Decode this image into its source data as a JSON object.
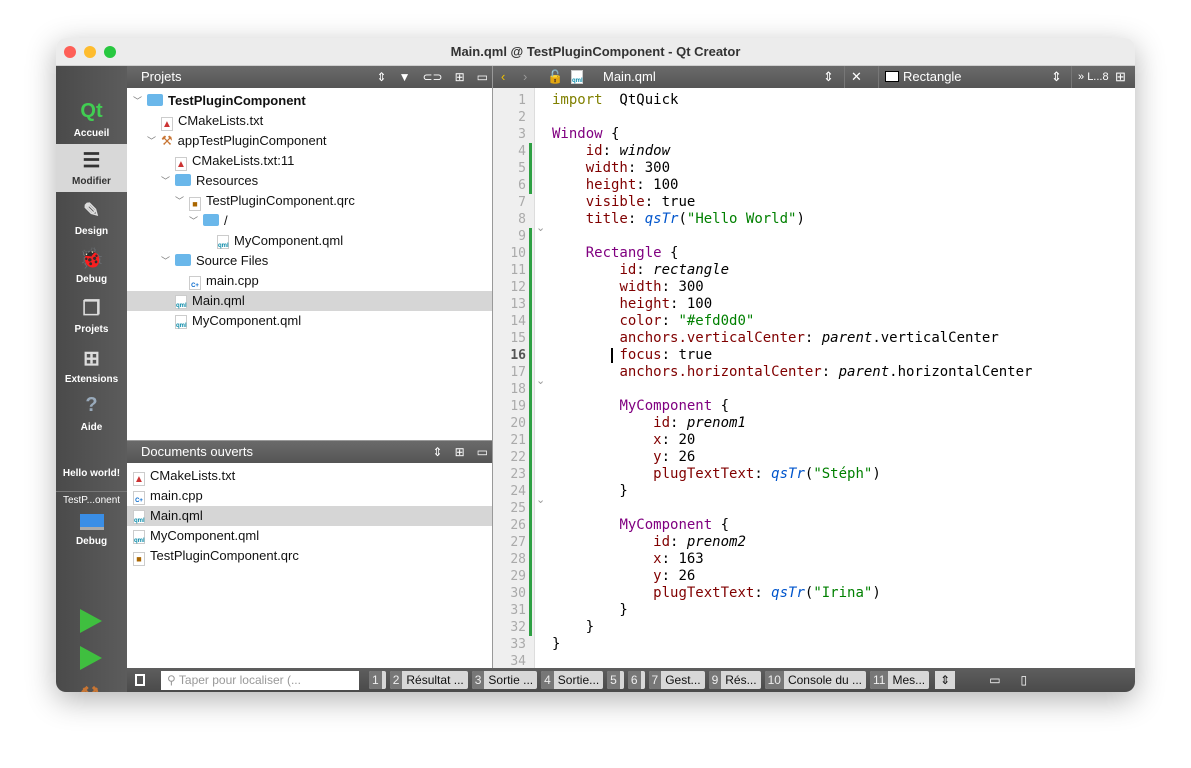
{
  "window": {
    "title": "Main.qml @ TestPluginComponent - Qt Creator"
  },
  "modes": [
    {
      "label": "Accueil",
      "icon": "qt-logo-icon"
    },
    {
      "label": "Modifier",
      "icon": "edit-document-icon"
    },
    {
      "label": "Design",
      "icon": "design-brush-icon"
    },
    {
      "label": "Debug",
      "icon": "debug-bug-icon"
    },
    {
      "label": "Projets",
      "icon": "projects-folder-icon"
    },
    {
      "label": "Extensions",
      "icon": "extensions-icon"
    },
    {
      "label": "Aide",
      "icon": "help-icon"
    }
  ],
  "run": {
    "project": "Hello world!",
    "target": "TestP...onent",
    "build_config": "Debug"
  },
  "projects": {
    "title": "Projets",
    "tree": [
      {
        "label": "TestPluginComponent",
        "depth": 0,
        "icon": "project-folder",
        "bold": true,
        "arrow": true
      },
      {
        "label": "CMakeLists.txt",
        "depth": 1,
        "icon": "cmake"
      },
      {
        "label": "appTestPluginComponent",
        "depth": 1,
        "icon": "hammer",
        "arrow": true
      },
      {
        "label": "CMakeLists.txt:11",
        "depth": 2,
        "icon": "cmake"
      },
      {
        "label": "Resources",
        "depth": 2,
        "icon": "folder-lock",
        "arrow": true
      },
      {
        "label": "TestPluginComponent.qrc",
        "depth": 3,
        "icon": "qrc",
        "arrow": true
      },
      {
        "label": "/",
        "depth": 4,
        "icon": "folder",
        "arrow": true
      },
      {
        "label": "MyComponent.qml",
        "depth": 5,
        "icon": "qml"
      },
      {
        "label": "Source Files",
        "depth": 2,
        "icon": "folder-cpp",
        "arrow": true
      },
      {
        "label": "main.cpp",
        "depth": 3,
        "icon": "cpp"
      },
      {
        "label": "Main.qml",
        "depth": 2,
        "icon": "qml",
        "selected": true
      },
      {
        "label": "MyComponent.qml",
        "depth": 2,
        "icon": "qml"
      }
    ]
  },
  "open_docs": {
    "title": "Documents ouverts",
    "items": [
      {
        "label": "CMakeLists.txt",
        "icon": "cmake"
      },
      {
        "label": "main.cpp",
        "icon": "cpp"
      },
      {
        "label": "Main.qml",
        "icon": "qml",
        "selected": true
      },
      {
        "label": "MyComponent.qml",
        "icon": "qml"
      },
      {
        "label": "TestPluginComponent.qrc",
        "icon": "qrc"
      }
    ]
  },
  "editor": {
    "file": "Main.qml",
    "symbol": "Rectangle",
    "line_indicator": "L...8",
    "current_line": 16,
    "lines": [
      [
        [
          "kw",
          "import"
        ],
        [
          "",
          "  QtQuick"
        ]
      ],
      [],
      [
        [
          "ty",
          "Window"
        ],
        [
          "",
          " {"
        ]
      ],
      [
        [
          "",
          "    "
        ],
        [
          "pr",
          "id"
        ],
        [
          "",
          ": "
        ],
        [
          "it",
          "window"
        ]
      ],
      [
        [
          "",
          "    "
        ],
        [
          "pr",
          "width"
        ],
        [
          "",
          ": 300"
        ]
      ],
      [
        [
          "",
          "    "
        ],
        [
          "pr",
          "height"
        ],
        [
          "",
          ": 100"
        ]
      ],
      [
        [
          "",
          "    "
        ],
        [
          "pr",
          "visible"
        ],
        [
          "",
          ": true"
        ]
      ],
      [
        [
          "",
          "    "
        ],
        [
          "pr",
          "title"
        ],
        [
          "",
          ": "
        ],
        [
          "fn",
          "qsTr"
        ],
        [
          "",
          "("
        ],
        [
          "st",
          "\"Hello World\""
        ],
        [
          "",
          ")"
        ]
      ],
      [],
      [
        [
          "",
          "    "
        ],
        [
          "ty",
          "Rectangle"
        ],
        [
          "",
          "",
          " {"
        ]
      ],
      [
        [
          "",
          "        "
        ],
        [
          "pr",
          "id"
        ],
        [
          "",
          ": "
        ],
        [
          "it",
          "rectangle"
        ]
      ],
      [
        [
          "",
          "        "
        ],
        [
          "pr",
          "width"
        ],
        [
          "",
          ": 300"
        ]
      ],
      [
        [
          "",
          "        "
        ],
        [
          "pr",
          "height"
        ],
        [
          "",
          ": 100"
        ]
      ],
      [
        [
          "",
          "        "
        ],
        [
          "pr",
          "color"
        ],
        [
          "",
          ": "
        ],
        [
          "st",
          "\"#efd0d0\""
        ]
      ],
      [
        [
          "",
          "        "
        ],
        [
          "pr",
          "anchors.verticalCenter"
        ],
        [
          "",
          ": "
        ],
        [
          "it",
          "parent"
        ],
        [
          "",
          ".verticalCenter"
        ]
      ],
      [
        [
          "",
          "        "
        ],
        [
          "pr",
          "focus"
        ],
        [
          "",
          ": true"
        ]
      ],
      [
        [
          "",
          "        "
        ],
        [
          "pr",
          "anchors.horizontalCenter"
        ],
        [
          "",
          ": "
        ],
        [
          "it",
          "parent"
        ],
        [
          "",
          ".horizontalCenter"
        ]
      ],
      [],
      [
        [
          "",
          "        "
        ],
        [
          "ty",
          "MyComponent"
        ],
        [
          "",
          "",
          " {"
        ]
      ],
      [
        [
          "",
          "            "
        ],
        [
          "pr",
          "id"
        ],
        [
          "",
          ": "
        ],
        [
          "it",
          "prenom1"
        ]
      ],
      [
        [
          "",
          "            "
        ],
        [
          "pr",
          "x"
        ],
        [
          "",
          ": 20"
        ]
      ],
      [
        [
          "",
          "            "
        ],
        [
          "pr",
          "y"
        ],
        [
          "",
          ": 26"
        ]
      ],
      [
        [
          "",
          "            "
        ],
        [
          "pr",
          "plugTextText"
        ],
        [
          "",
          ": "
        ],
        [
          "fn",
          "qsTr"
        ],
        [
          "",
          "("
        ],
        [
          "st",
          "\"Stéph\""
        ],
        [
          "",
          ")"
        ]
      ],
      [
        [
          "",
          "        }"
        ]
      ],
      [],
      [
        [
          "",
          "        "
        ],
        [
          "ty",
          "MyComponent"
        ],
        [
          "",
          "",
          " {"
        ]
      ],
      [
        [
          "",
          "            "
        ],
        [
          "pr",
          "id"
        ],
        [
          "",
          ": "
        ],
        [
          "it",
          "prenom2"
        ]
      ],
      [
        [
          "",
          "            "
        ],
        [
          "pr",
          "x"
        ],
        [
          "",
          ": 163"
        ]
      ],
      [
        [
          "",
          "            "
        ],
        [
          "pr",
          "y"
        ],
        [
          "",
          ": 26"
        ]
      ],
      [
        [
          "",
          "            "
        ],
        [
          "pr",
          "plugTextText"
        ],
        [
          "",
          ": "
        ],
        [
          "fn",
          "qsTr"
        ],
        [
          "",
          "("
        ],
        [
          "st",
          "\"Irina\""
        ],
        [
          "",
          ")"
        ]
      ],
      [
        [
          "",
          "        }"
        ]
      ],
      [
        [
          "",
          "    }"
        ]
      ],
      [
        [
          "",
          "}"
        ]
      ],
      []
    ]
  },
  "bottom": {
    "search_placeholder": "Taper pour localiser (...",
    "tabs": [
      {
        "n": "1",
        "label": ""
      },
      {
        "n": "2",
        "label": "Résultat ..."
      },
      {
        "n": "3",
        "label": "Sortie ..."
      },
      {
        "n": "4",
        "label": "Sortie..."
      },
      {
        "n": "5",
        "label": ""
      },
      {
        "n": "6",
        "label": ""
      },
      {
        "n": "7",
        "label": "Gest..."
      },
      {
        "n": "9",
        "label": "Rés..."
      },
      {
        "n": "10",
        "label": "Console du ..."
      },
      {
        "n": "11",
        "label": "Mes..."
      }
    ]
  },
  "colors": {
    "accent_green": "#2ea043",
    "selection": "#d6d6d6"
  }
}
